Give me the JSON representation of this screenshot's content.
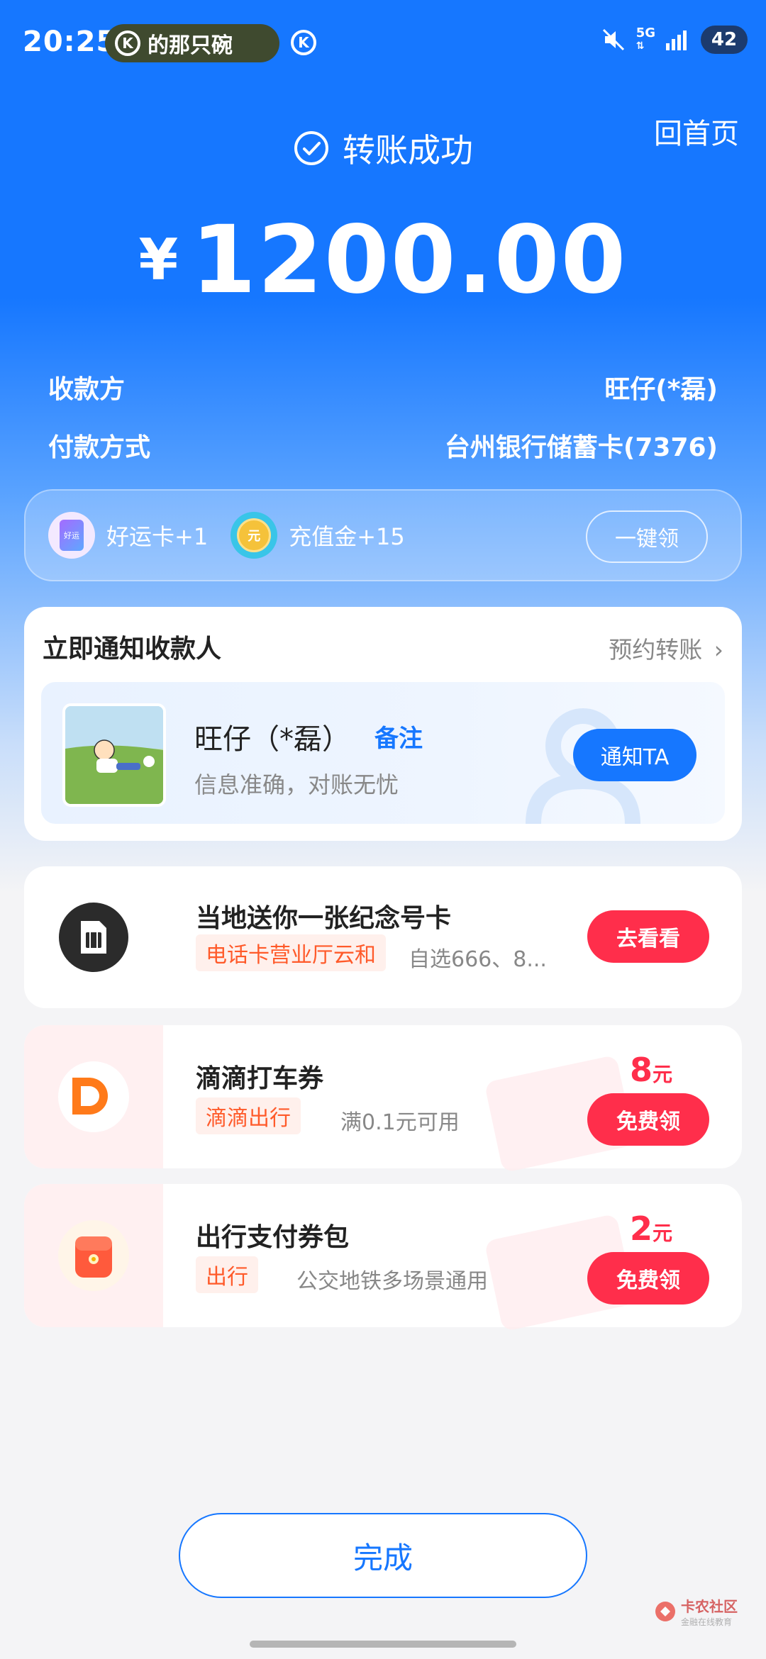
{
  "status_bar": {
    "time": "20:25",
    "pill_text": "的那只碗",
    "k_badge": "K",
    "network": "5G",
    "battery": "42"
  },
  "header": {
    "home_link": "回首页",
    "status_text": "转账成功",
    "currency_symbol": "¥",
    "amount": "1200.00"
  },
  "details": {
    "payee_label": "收款方",
    "payee_value": "旺仔(*磊)",
    "method_label": "付款方式",
    "method_value": "台州银行储蓄卡(7376)"
  },
  "rewards": {
    "item1_icon_text": "好运",
    "item1_label": "好运卡+1",
    "item2_icon_text": "元",
    "item2_label": "充值金+15",
    "claim_all_label": "一键领"
  },
  "notify": {
    "title": "立即通知收款人",
    "schedule_label": "预约转账",
    "payee_name": "旺仔（*磊）",
    "note_label": "备注",
    "subtitle": "信息准确，对账无忧",
    "notify_button": "通知TA"
  },
  "promos": [
    {
      "title": "当地送你一张纪念号卡",
      "tag": "电话卡营业厅云和",
      "desc": "自选666、8...",
      "button": "去看看",
      "icon": "sim-card-icon"
    },
    {
      "title": "滴滴打车券",
      "tag": "滴滴出行",
      "desc": "满0.1元可用",
      "price": "8",
      "unit": "元",
      "button": "免费领",
      "icon": "didi-logo-icon"
    },
    {
      "title": "出行支付券包",
      "tag": "出行",
      "desc": "公交地铁多场景通用",
      "price": "2",
      "unit": "元",
      "button": "免费领",
      "icon": "wallet-bag-icon"
    }
  ],
  "footer": {
    "done_label": "完成",
    "watermark_main": "卡农社区",
    "watermark_sub": "金融在线教育"
  },
  "colors": {
    "primary": "#1677ff",
    "promo_red": "#ff2e4b",
    "tag_orange": "#ff5a2a",
    "didi_orange": "#ff7a1a"
  }
}
